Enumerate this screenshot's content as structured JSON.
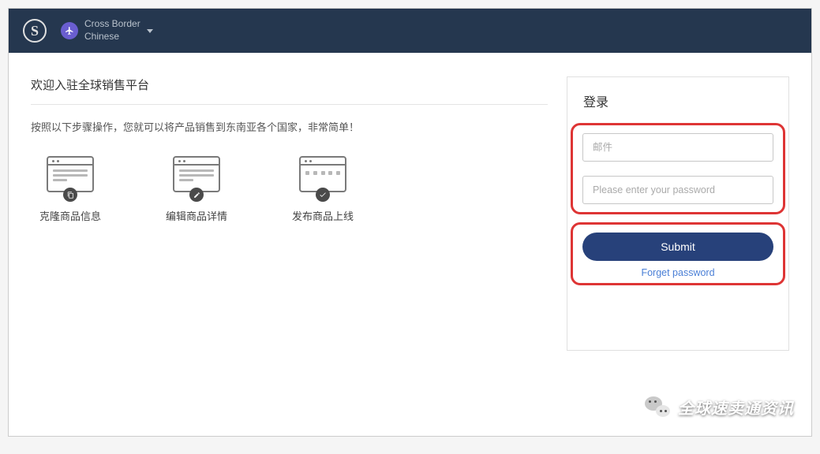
{
  "topbar": {
    "logo_letter": "S",
    "line1": "Cross Border",
    "line2": "Chinese"
  },
  "welcome": {
    "title": "欢迎入驻全球销售平台",
    "subtitle": "按照以下步骤操作，您就可以将产品销售到东南亚各个国家，非常简单！"
  },
  "steps": [
    {
      "label": "克隆商品信息"
    },
    {
      "label": "编辑商品详情"
    },
    {
      "label": "发布商品上线"
    }
  ],
  "login": {
    "title": "登录",
    "email_placeholder": "邮件",
    "password_placeholder": "Please enter your password",
    "submit_label": "Submit",
    "forget_label": "Forget password"
  },
  "watermark": {
    "text": "全球速卖通资讯"
  }
}
